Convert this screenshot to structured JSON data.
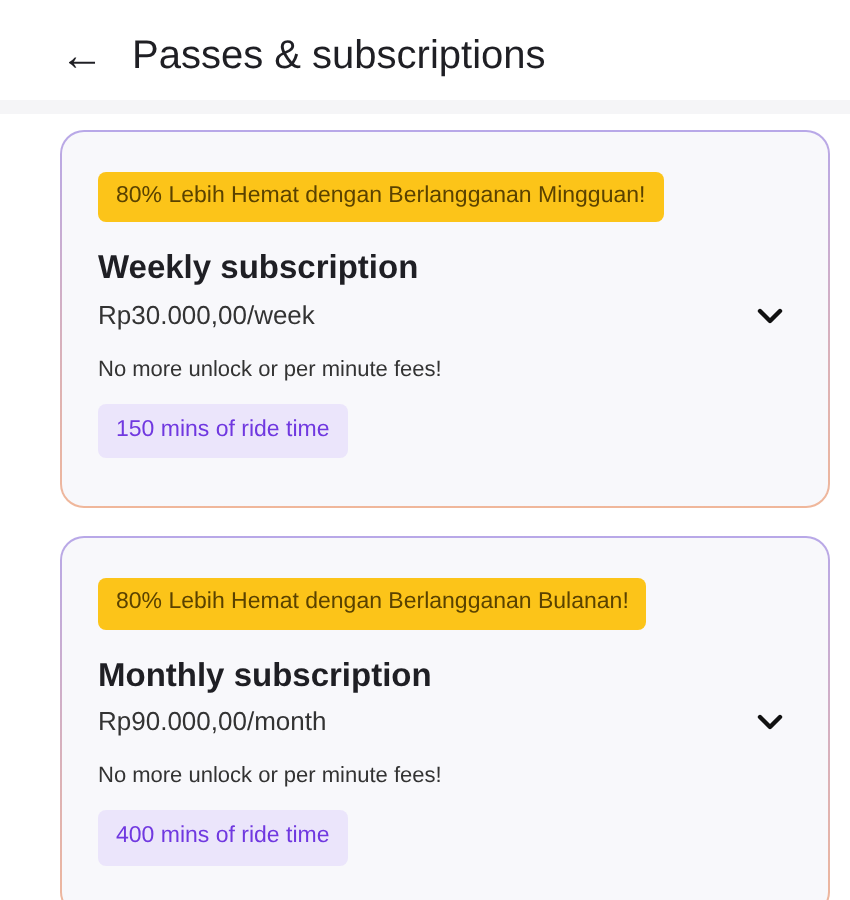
{
  "header": {
    "back_icon": "←",
    "title": "Passes & subscriptions"
  },
  "plans": [
    {
      "promo": "80% Lebih Hemat dengan Berlangganan Mingguan!",
      "name": "Weekly subscription",
      "price": "Rp30.000,00/week",
      "description": "No more unlock or per minute fees!",
      "ride_time": "150 mins of ride time",
      "expanded": false
    },
    {
      "promo": "80% Lebih Hemat dengan Berlangganan Bulanan!",
      "name": "Monthly subscription",
      "price": "Rp90.000,00/month",
      "description": "No more unlock or per minute fees!",
      "ride_time": "400 mins of ride time",
      "expanded": false
    }
  ]
}
